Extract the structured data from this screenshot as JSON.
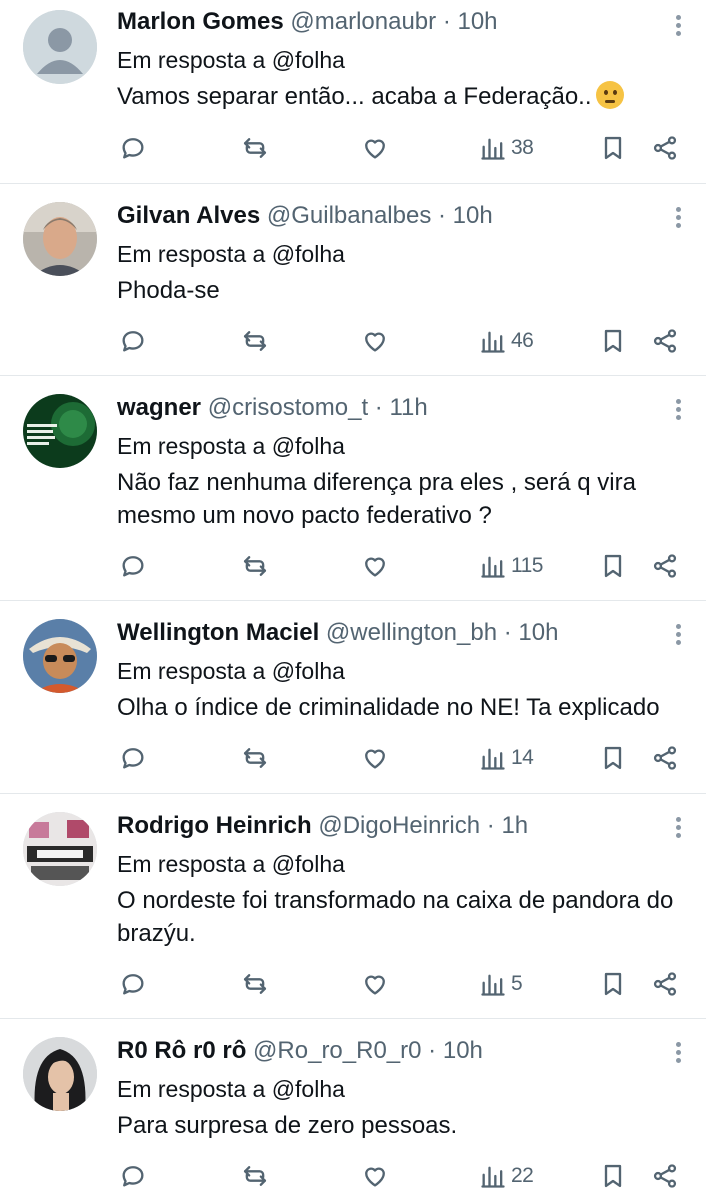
{
  "reply_prefix": "Em resposta a",
  "reply_mention": "@folha",
  "views_count_label": "views",
  "tweets": [
    {
      "name": "Marlon Gomes",
      "handle": "@marlonaubr",
      "time": "10h",
      "text": "Vamos separar então... acaba a Federação..",
      "emoji": "thinking-face",
      "views": "38",
      "avatar": "default-avatar"
    },
    {
      "name": "Gilvan Alves",
      "handle": "@Guilbanalbes",
      "time": "10h",
      "text": "Phoda-se",
      "views": "46",
      "avatar": "photo-man"
    },
    {
      "name": "wagner",
      "handle": "@crisostomo_t",
      "time": "11h",
      "text": "Não faz nenhuma diferença pra eles , será q vira mesmo um novo pacto federativo ?",
      "views": "115",
      "avatar": "green-logo"
    },
    {
      "name": "Wellington Maciel",
      "handle": "@wellington_bh",
      "time": "10h",
      "text": "Olha o índice de criminalidade no NE! Ta explicado",
      "views": "14",
      "avatar": "cartoon-man"
    },
    {
      "name": "Rodrigo Heinrich",
      "handle": "@DigoHeinrich",
      "time": "1h",
      "text": "O nordeste foi transformado na caixa de pandora do brazýu.",
      "views": "5",
      "avatar": "collage"
    },
    {
      "name": "R0 Rô r0 rô",
      "handle": "@Ro_ro_R0_r0",
      "time": "10h",
      "text": "Para surpresa de zero pessoas.",
      "views": "22",
      "avatar": "woman-photo"
    }
  ]
}
